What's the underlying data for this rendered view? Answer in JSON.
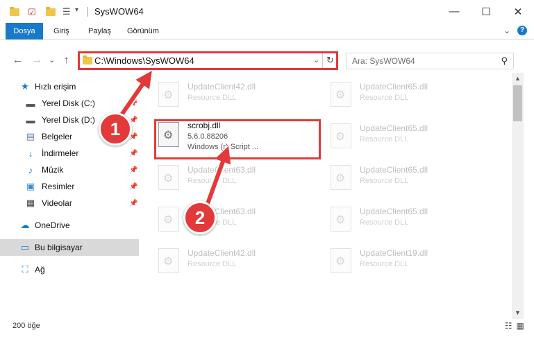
{
  "window": {
    "title": "SysWOW64",
    "minimize": "—",
    "maximize": "☐",
    "close": "✕"
  },
  "ribbon": {
    "tabs": [
      "Dosya",
      "Giriş",
      "Paylaş",
      "Görünüm"
    ],
    "expand": "⌄",
    "help": "?"
  },
  "nav": {
    "back": "←",
    "forward": "→",
    "recent": "⌄",
    "up": "↑"
  },
  "address": {
    "path": "C:\\Windows\\SysWOW64",
    "dropdown": "⌄",
    "refresh": "↻"
  },
  "search": {
    "placeholder": "Ara: SysWOW64",
    "icon": "⚲"
  },
  "sidebar": {
    "quick_access": "Hızlı erişim",
    "items": [
      {
        "label": "Yerel Disk (C:)",
        "icon": "drive-icon",
        "pinned": true
      },
      {
        "label": "Yerel Disk (D:)",
        "icon": "drive-icon",
        "pinned": true
      },
      {
        "label": "Belgeler",
        "icon": "documents-icon",
        "pinned": true
      },
      {
        "label": "İndirmeler",
        "icon": "downloads-icon",
        "pinned": true
      },
      {
        "label": "Müzik",
        "icon": "music-icon",
        "pinned": true
      },
      {
        "label": "Resimler",
        "icon": "pictures-icon",
        "pinned": true
      },
      {
        "label": "Videolar",
        "icon": "videos-icon",
        "pinned": true
      }
    ],
    "onedrive": "OneDrive",
    "this_pc": "Bu bilgisayar",
    "network": "Ağ"
  },
  "files": {
    "left_column": [
      {
        "name": "UpdateClient42.dll",
        "type": "Resource DLL"
      },
      {
        "name": "scrobj.dll",
        "version": "5.6.0.88206",
        "desc": "Windows (r) Script ..."
      },
      {
        "name": "UpdateClient63.dll",
        "type": "Resource DLL"
      },
      {
        "name": "UpdateClient63.dll",
        "type": "Resource DLL"
      },
      {
        "name": "UpdateClient42.dll",
        "type": "Resource DLL"
      }
    ],
    "right_column": [
      {
        "name": "UpdateClient65.dll",
        "type": "Resource DLL"
      },
      {
        "name": "UpdateClient65.dll",
        "type": "Resource DLL"
      },
      {
        "name": "UpdateClient65.dll",
        "type": "Resource DLL"
      },
      {
        "name": "UpdateClient65.dll",
        "type": "Resource DLL"
      },
      {
        "name": "UpdateClient19.dll",
        "type": "Resource DLL"
      }
    ]
  },
  "status": {
    "count": "200 öğe"
  },
  "annotations": {
    "step1": "1",
    "step2": "2",
    "color": "#e3393a"
  }
}
